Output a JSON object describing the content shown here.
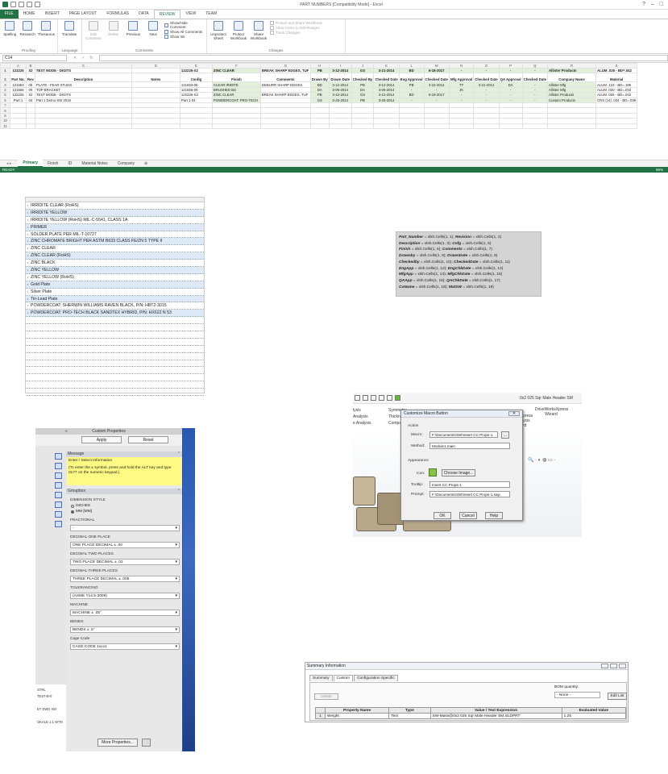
{
  "excel": {
    "title": "PART NUMBERS [Compatibility Mode] - Excel",
    "tabs": [
      "FILE",
      "HOME",
      "INSERT",
      "PAGE LAYOUT",
      "FORMULAS",
      "DATA",
      "REVIEW",
      "VIEW",
      "TEAM"
    ],
    "active_tab": "REVIEW",
    "ribbon": {
      "proofing": {
        "label": "Proofing",
        "buttons": [
          "Spelling",
          "Research",
          "Thesaurus"
        ]
      },
      "language": {
        "label": "Language",
        "buttons": [
          "Translate"
        ]
      },
      "comments": {
        "label": "Comments",
        "buttons": [
          "Edit Comment",
          "Delete",
          "Previous",
          "Next"
        ],
        "small": [
          "Show/Hide Comment",
          "Show All Comments",
          "Show Ink"
        ]
      },
      "changes": {
        "label": "Changes",
        "buttons": [
          "Unprotect Sheet",
          "Protect Workbook",
          "Share Workbook"
        ],
        "small": [
          "Protect and Share Workbook",
          "Allow Users to Edit Ranges",
          "Track Changes"
        ]
      }
    },
    "name_box": "C14",
    "formula_icons": [
      "✕",
      "✓",
      "fx"
    ],
    "columns": [
      "A",
      "B",
      "C",
      "D",
      "E",
      "F",
      "G",
      "H",
      "I",
      "J",
      "K",
      "L",
      "M",
      "N",
      "O",
      "P",
      "Q",
      "R",
      "S"
    ],
    "row1": [
      "122225",
      "X2",
      "TEST MODE - DIGITS",
      "",
      "122225-X2",
      "ZINC CLEAR",
      "BREAK SHARP EDGES, TUF",
      "PB",
      "3-12-2014",
      "GS",
      "3-21-2014",
      "BD",
      "6-18-2017",
      "-",
      "-",
      "-",
      "-",
      "Allister Products",
      "ALUM .025 - BD=.042"
    ],
    "row2": [
      "Part No.",
      "Rev",
      "Description",
      "Notes",
      "Config",
      "Finish",
      "Comments",
      "Drawn By",
      "Drawn Date",
      "Checked By",
      "Checked Date",
      "Eng Approval",
      "Checked Date",
      "Mfg Approval",
      "Checked Date",
      "QA Approval",
      "Checked Date",
      "Company Name",
      "Material"
    ],
    "data_rows": [
      [
        "121653",
        "05",
        "PLATE - FEAR STUDS",
        "",
        "121653-05",
        "CLEAR IRIDITE",
        "DEBURR SHARP EDGES",
        "BD",
        "3-12-2014",
        "PB",
        "3-12-2014",
        "PB",
        "3-22-2014",
        "TT",
        "3-21-2014",
        "DA",
        "-",
        "Allister Mfg",
        "ALUM .123 - BD=.185"
      ],
      [
        "121556",
        "00",
        "TOP BRACKET",
        "",
        "121556-00",
        "BRUSHED BS",
        "",
        "DA",
        "3-05-2014",
        "DA",
        "3-06-2014",
        "-",
        "-",
        "JK",
        "-",
        "-",
        "-",
        "Allister Mfg",
        "ALUM .020 - BD=.032"
      ],
      [
        "122225",
        "X2",
        "TEST MODE - DIGITS",
        "",
        "122225-X2",
        "ZINC CLEAR",
        "BREAK SHARP EDGES, TUF",
        "PB",
        "3-12-2014",
        "GS",
        "3-21-2014",
        "BD",
        "6-18-2017",
        "-",
        "-",
        "-",
        "-",
        "Allister Products",
        "ALUM .025 - BD=.042"
      ],
      [
        "Part 1",
        "04",
        "Part 1 Demo SW 2019",
        "",
        "Part 1-04",
        "POWDERCOAT: PRO-TECH",
        "",
        "GS",
        "3-25-2014",
        "PB",
        "3-25-2014",
        "-",
        "-",
        "-",
        "-",
        "-",
        "-",
        "Custom Products",
        "CRS (14) .024 - BD=.039"
      ]
    ],
    "row_numbers": [
      "1",
      "2",
      "3",
      "4",
      "5",
      "6",
      "7",
      "8",
      "9",
      "10",
      "11"
    ],
    "sheet_tabs": [
      "Primary",
      "Finish",
      "ID",
      "Material Notes",
      "Company"
    ],
    "active_sheet": "Primary",
    "status": "READY",
    "zoom": "85%"
  },
  "coatings": {
    "items": [
      "IRRIDITE CLEAR (RoHS)",
      "IRRIDITE YELLOW",
      "IRRIDITE YELLOW (RoHS) MIL-C-5541, CLASS 1A",
      "PRIMER",
      "SOLDER PLATE PER MIL-T-10727",
      "ZINC CHROMATE BRIGHT PER ASTM B633 CLASS FE/ZN 5 TYPE II",
      "ZINC CLEAR",
      "ZINC CLEAR (RoHS)",
      "ZINC BLACK",
      "ZINC YELLOW",
      "ZINC YELLOW (RoHS)",
      "Gold Plate",
      "Silver Plate",
      "Tin-Lead Plate",
      "POWDERCOAT: SHERWIN WILLIAMS RAVEN BLACK, P/N: HBT2-3015",
      "POWDERCOAT: PRO-TECH BLACK SANDTEX HYBRID, P/N: HX622 N 53"
    ],
    "empty_rows": 11
  },
  "code": {
    "lines": [
      [
        [
          "Part_Number",
          " = xlsh.Cells(1, 1);  "
        ],
        [
          "Revision",
          " = xlsh.Cells(1, 2)"
        ]
      ],
      [
        [
          "Description",
          " = xlsh.Cells(1, 3);  "
        ],
        [
          "Cnfg",
          " = xlsh.Cells(1, 5)"
        ]
      ],
      [
        [
          "Finish",
          " = xlsh.Cells(1, 6);  "
        ],
        [
          "Comments",
          " = xlsh.Cells(1, 7)"
        ]
      ],
      [
        [
          "Drawnby",
          " = xlsh.Cells(1, 8);  "
        ],
        [
          "DrawnDate",
          " = xlsh.Cells(1, 9)"
        ]
      ],
      [
        [
          "Checkedby",
          " = xlsh.Cells(1, 10);  "
        ],
        [
          "CheckedDate",
          " = xlsh.Cells(1, 11)"
        ]
      ],
      [
        [
          "EngApp",
          " = xlsh.Cells(1, 12);  "
        ],
        [
          "EngChkDate",
          " = xlsh.Cells(1, 13)"
        ]
      ],
      [
        [
          "MfgApp",
          " = xlsh.Cells(1, 14);  "
        ],
        [
          "MfgChkDate",
          " = xlsh.Cells(1, 15)"
        ]
      ],
      [
        [
          "QAApp",
          " = xlsh.Cells(1, 16);  "
        ],
        [
          "QAChkDate",
          " = xlsh.Cells(1, 17)"
        ]
      ],
      [
        [
          "CoName",
          " = xlsh.Cells(1, 18);  "
        ],
        [
          "MatSW",
          " = xlsh.Cells(1, 19)"
        ]
      ]
    ]
  },
  "custom_props": {
    "title": "Custom Properties",
    "apply": "Apply",
    "reset": "Reset",
    "message_header": "Message",
    "message_line1": "Enter / Select Information",
    "message_line2": "(To enter the ± symbol, press and hold the ALT key and type 0177 on the numeric keypad.)",
    "groupbox_header": "Groupbox",
    "dim_style_label": "DIMENSION STYLE",
    "radio_inches": "INCHES",
    "radio_mm": "MM [MM]",
    "fields": [
      {
        "label": "FRACTIONAL",
        "value": "-"
      },
      {
        "label": "DECIMAL ONE PLACE",
        "value": "ONE PLACE DECIMAL ± .00"
      },
      {
        "label": "DECIMAL TWO PLACES",
        "value": "TWO PLACE DECIMAL ± .01"
      },
      {
        "label": "DECIMAL THREE PLACES",
        "value": "THREE PLACE DECIMAL ± .005"
      },
      {
        "label": "TOLERANCING",
        "value": "(ASME Y14.5-2009)"
      },
      {
        "label": "MACHINE",
        "value": "MACHINE ± .05°"
      },
      {
        "label": "BENDS",
        "value": "BENDS  ± .5°"
      },
      {
        "label": "Cage Code",
        "value": "CAGE CODE 1xxx1"
      }
    ],
    "more_properties": "More Properties...",
    "sw_fragment": [
      "STRL",
      "TEST-B-0",
      "",
      "ET  DWG  NO",
      "",
      "OKALE 1:1  WTN"
    ]
  },
  "sw": {
    "title": "0x2 025 Sqr Male Header SM",
    "cmd_left": [
      "lysis",
      "Analysis",
      "e Analysis"
    ],
    "cmd_items": [
      "Symmetry",
      "Thickness",
      "Compare"
    ],
    "cmd_right": [
      "DriveWorksXpress Wizard",
      "press ysis rd"
    ],
    "dialog": {
      "title": "Customize Macro Button",
      "action": "Action",
      "macro_label": "Macro:",
      "macro_value": "F:\\Documents\\SW\\Insert CC Props-1.",
      "browse": "...",
      "method_label": "Method:",
      "method_value": "Module1.main",
      "appearance": "Appearance",
      "icon_label": "Icon:",
      "choose_image": "Choose Image...",
      "tooltip_label": "Tooltip:",
      "tooltip_value": "Insert CC Props-1",
      "prompt_label": "Prompt:",
      "prompt_value": "F:\\Documents\\SW\\Insert CC Props-1.swp",
      "ok": "OK",
      "cancel": "Cancel",
      "help": "Help"
    }
  },
  "summary": {
    "title": "Summary Information",
    "tabs": [
      "Summary",
      "Custom",
      "Configuration Specific"
    ],
    "active_tab": "Custom",
    "delete": "Delete",
    "bom_label": "BOM quantity:",
    "bom_value": "- None -",
    "edit_list": "Edit List",
    "headers": [
      "",
      "Property Name",
      "Type",
      "Value / Text Expression",
      "Evaluated Value"
    ],
    "row": [
      "1",
      "Weight",
      "Text",
      "SW-Mass@0x2 025 Sqr Male Header SM.SLDPRT'",
      "1.25"
    ]
  }
}
